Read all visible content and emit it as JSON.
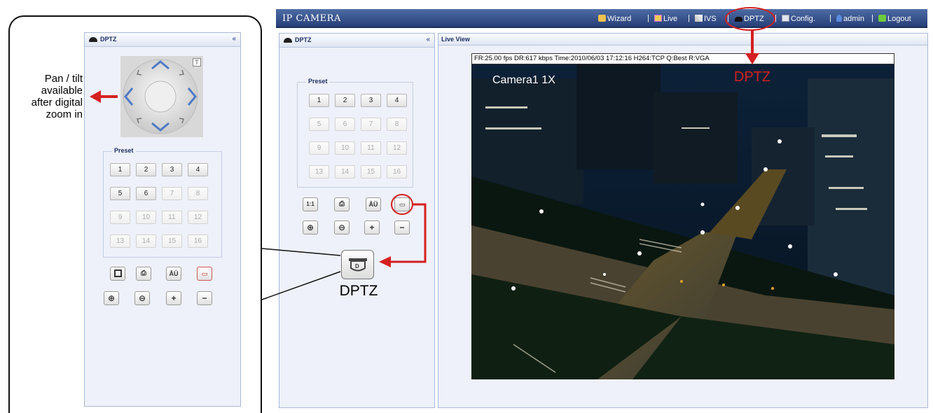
{
  "app": {
    "title": "IP CAMERA"
  },
  "nav": [
    {
      "label": "Wizard",
      "icon": "wizard-icon"
    },
    {
      "label": "Live",
      "icon": "live-icon"
    },
    {
      "label": "IVS",
      "icon": "ivs-icon"
    },
    {
      "label": "DPTZ",
      "icon": "dptz-icon"
    },
    {
      "label": "Config.",
      "icon": "config-icon"
    },
    {
      "label": "admin",
      "icon": "user-icon"
    },
    {
      "label": "Logout",
      "icon": "logout-icon"
    }
  ],
  "nav_separator": "|",
  "dptz_panel": {
    "title": "DPTZ",
    "collapse": "«",
    "preset_label": "Preset",
    "presets": [
      "1",
      "2",
      "3",
      "4",
      "5",
      "6",
      "7",
      "8",
      "9",
      "10",
      "11",
      "12",
      "13",
      "14",
      "15",
      "16"
    ]
  },
  "live_view": {
    "title": "Live View",
    "info": "FR:25.00 fps  DR:617 kbps Time:2010/06/03 17:12:16 H264:TCP Q:Best R:VGA",
    "camera_label": "Camera1 1X"
  },
  "joystick": {
    "t_label": "T",
    "dptz_badge": "D"
  },
  "toolbar": {
    "original_size": "1:1",
    "zoom_in": "⊕",
    "zoom_out": "⊖",
    "plus": "+",
    "minus": "−"
  },
  "annotations": {
    "dptz_top": "DPTZ",
    "dptz_button": "DPTZ",
    "pan_tilt_note": [
      "Pan / tilt",
      "available",
      "after digital",
      "zoom in"
    ]
  },
  "colors": {
    "accent_red": "#d42020",
    "header_blue": "#2e4780",
    "panel_bg": "#eef1f9"
  }
}
